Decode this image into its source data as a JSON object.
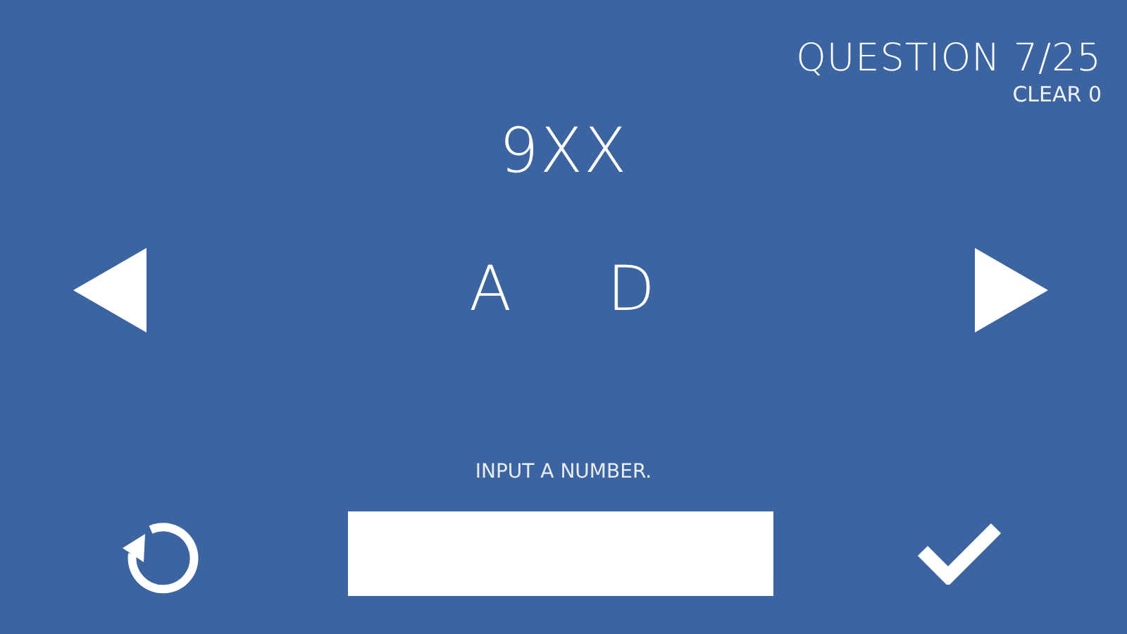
{
  "header": {
    "question": "QUESTION 7/25",
    "clear": "CLEAR 0"
  },
  "code": "9XX",
  "letters": [
    "A",
    "D"
  ],
  "hint": "INPUT A NUMBER."
}
